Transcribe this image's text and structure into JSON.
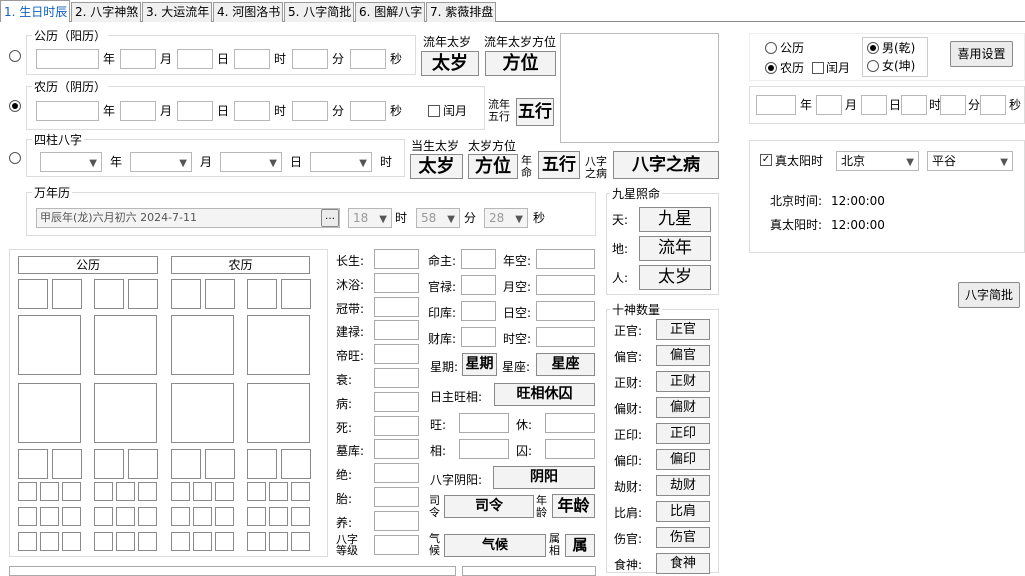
{
  "tabs": [
    "1. 生日时辰",
    "2. 八字神煞",
    "3. 大运流年",
    "4. 河图洛书",
    "5. 八字简批",
    "6. 图解八字",
    "7. 紫薇排盘"
  ],
  "gregorian": {
    "title": "公历（阳历）",
    "year": "年",
    "month": "月",
    "day": "日",
    "hour": "时",
    "minute": "分",
    "second": "秒"
  },
  "lunar": {
    "title": "农历（阴历）",
    "year": "年",
    "month": "月",
    "day": "日",
    "hour": "时",
    "minute": "分",
    "second": "秒",
    "leap": "闰月"
  },
  "sizhu": {
    "title": "四柱八字",
    "year": "年",
    "month": "月",
    "day": "日",
    "hour": "时"
  },
  "liunian": {
    "taisui_label": "流年太岁",
    "fangwei_label": "流年太岁方位",
    "taisui": "太岁",
    "fangwei": "方位",
    "wuxing_label": "流年五行",
    "wuxing": "五行"
  },
  "dangsheng": {
    "taisui_label": "当生太岁",
    "fangwei_label": "太岁方位",
    "taisui": "太岁",
    "fangwei": "方位",
    "ming_label": "年命",
    "wuxing": "五行",
    "bing_label": "八字之病",
    "bing": "八字之病"
  },
  "wannianli": {
    "title": "万年历",
    "date_value": "甲辰年(龙)六月初六 2024-7-11",
    "hour_val": "18",
    "hour": "时",
    "minute_val": "58",
    "minute": "分",
    "second_val": "28",
    "second": "秒"
  },
  "jiuxing": {
    "title": "九星照命",
    "tian": "天:",
    "tian_val": "九星",
    "di": "地:",
    "di_val": "流年",
    "ren": "人:",
    "ren_val": "太岁"
  },
  "right": {
    "gongli": "公历",
    "nongli": "农历",
    "leap": "闰月",
    "male": "男(乾)",
    "female": "女(坤)",
    "prefs": "喜用设置",
    "year": "年",
    "month": "月",
    "day": "日",
    "hour": "时",
    "minute": "分",
    "second": "秒"
  },
  "solar": {
    "check": "真太阳时",
    "city": "北京",
    "district": "平谷",
    "bj_label": "北京时间:",
    "bj_time": "12:00:00",
    "solar_label": "真太阳时:",
    "solar_time": "12:00:00"
  },
  "jianpi_btn": "八字简批",
  "chart": {
    "gongli": "公历",
    "nongli": "农历"
  },
  "changsheng": [
    "长生:",
    "沐浴:",
    "冠带:",
    "建禄:",
    "帝旺:",
    "衰:",
    "病:",
    "死:",
    "墓库:",
    "绝:",
    "胎:",
    "养:",
    "八字等级"
  ],
  "info": {
    "mingzhu": "命主:",
    "niankong": "年空:",
    "guanlu": "官禄:",
    "yuekong": "月空:",
    "yinku": "印库:",
    "rikong": "日空:",
    "caiku": "财库:",
    "shikong": "时空:",
    "xingqi_label": "星期:",
    "xingqi": "星期",
    "xingzuo_label": "星座:",
    "xingzuo": "星座",
    "wangxiang_label": "日主旺相:",
    "wangxiang": "旺相休囚",
    "wang": "旺:",
    "xiu": "休:",
    "xiang": "相:",
    "qiu": "囚:",
    "yinyang_label": "八字阴阳:",
    "yinyang": "阴阳",
    "siling_label": "司令",
    "siling": "司令",
    "age_label": "年龄",
    "age": "年龄",
    "qihou_label": "气候",
    "qihou": "气候",
    "shu_label": "属相",
    "shu": "属"
  },
  "shishen": {
    "title": "十神数量",
    "items": [
      {
        "label": "正官:",
        "val": "正官"
      },
      {
        "label": "偏官:",
        "val": "偏官"
      },
      {
        "label": "正财:",
        "val": "正财"
      },
      {
        "label": "偏财:",
        "val": "偏财"
      },
      {
        "label": "正印:",
        "val": "正印"
      },
      {
        "label": "偏印:",
        "val": "偏印"
      },
      {
        "label": "劫财:",
        "val": "劫财"
      },
      {
        "label": "比肩:",
        "val": "比肩"
      },
      {
        "label": "伤官:",
        "val": "伤官"
      },
      {
        "label": "食神:",
        "val": "食神"
      }
    ]
  }
}
